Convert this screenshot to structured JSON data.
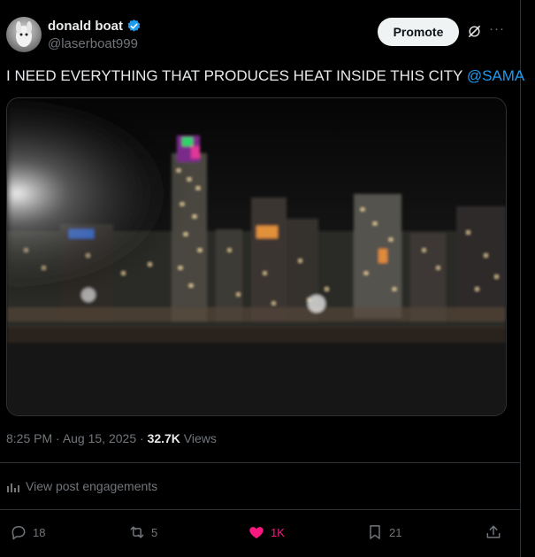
{
  "author": {
    "name": "donald boat",
    "handle": "@laserboat999",
    "verified": true
  },
  "header": {
    "promote_label": "Promote",
    "grok_icon": "grok-icon",
    "more_icon": "more-icon"
  },
  "tweet": {
    "text": "I NEED EVERYTHING THAT PRODUCES HEAT INSIDE THIS CITY ",
    "mention": "@SAMA"
  },
  "meta": {
    "time": "8:25 PM",
    "sep1": " · ",
    "date": "Aug 15, 2025",
    "sep2": " · ",
    "views_count": "32.7K",
    "views_label": " Views"
  },
  "engagements_label": "View post engagements",
  "actions": {
    "replies": "18",
    "reposts": "5",
    "likes": "1K",
    "bookmarks": "21"
  },
  "colors": {
    "accent": "#1d9bf0",
    "like": "#f91880",
    "verified": "#1d9bf0"
  }
}
